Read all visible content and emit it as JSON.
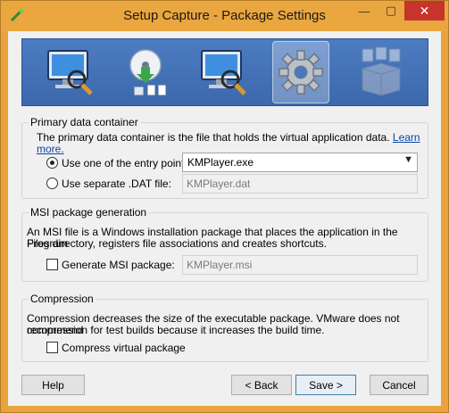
{
  "window": {
    "title": "Setup Capture - Package Settings",
    "controls": {
      "minimize": "—",
      "maximize": "▢",
      "close": "✕"
    }
  },
  "banner": {
    "steps": [
      {
        "icon": "monitor-magnifier-icon",
        "active": false
      },
      {
        "icon": "disc-install-icon",
        "active": false
      },
      {
        "icon": "monitor-magnifier-icon",
        "active": false
      },
      {
        "icon": "gear-icon",
        "active": true
      },
      {
        "icon": "package-box-icon",
        "active": false
      }
    ],
    "colors": {
      "background": "#4a77bd",
      "active": "#8fa9d6"
    }
  },
  "primary": {
    "title": "Primary data container",
    "description": "The primary data container is the file that holds the virtual application data.",
    "learn_more": "Learn more.",
    "option_entry_label": "Use one of the entry points:",
    "option_entry_selected": true,
    "entry_value": "KMPlayer.exe",
    "option_dat_label": "Use separate .DAT file:",
    "option_dat_selected": false,
    "dat_value": "KMPlayer.dat"
  },
  "msi": {
    "title": "MSI package generation",
    "description_line1": "An MSI file is a Windows installation package that places the application in the Program",
    "description_line2": "Files directory, registers file associations and creates shortcuts.",
    "generate_label": "Generate MSI package:",
    "generate_checked": false,
    "msi_value": "KMPlayer.msi"
  },
  "compression": {
    "title": "Compression",
    "description_line1": "Compression decreases the size of the executable package. VMware does not recommend",
    "description_line2": "compression for test builds because it increases the build time.",
    "compress_label": "Compress virtual package",
    "compress_checked": false
  },
  "buttons": {
    "help": "Help",
    "back": "< Back",
    "save": "Save >",
    "cancel": "Cancel"
  }
}
